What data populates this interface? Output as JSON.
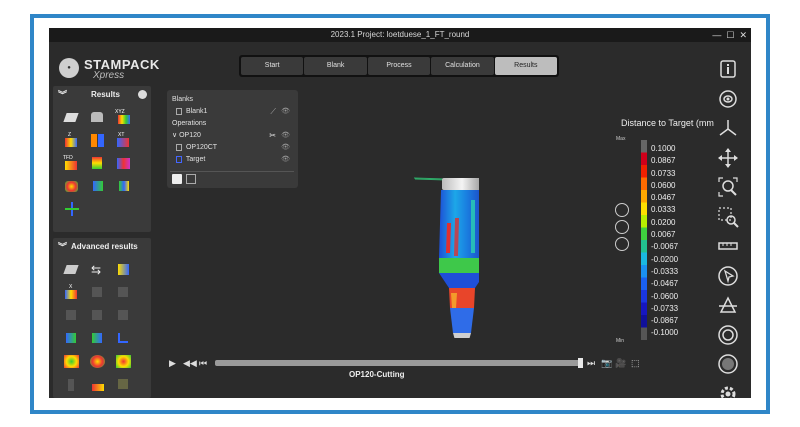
{
  "window": {
    "title": "2023.1  Project: loetduese_1_FT_round",
    "controls": [
      "—",
      "☐",
      "✕"
    ]
  },
  "logo": {
    "main": "STAMPACK",
    "sub": "Xpress"
  },
  "tabs": [
    {
      "label": "Start",
      "active": false
    },
    {
      "label": "Blank",
      "active": false
    },
    {
      "label": "Process",
      "active": false
    },
    {
      "label": "Calculation",
      "active": false
    },
    {
      "label": "Results",
      "active": true
    }
  ],
  "results_panel": {
    "title": "Results",
    "chevron": "︾"
  },
  "advanced_panel": {
    "title": "Advanced results",
    "chevron": "︾"
  },
  "tree": {
    "blanks_label": "Blanks",
    "blank1": "Blank1",
    "operations_label": "Operations",
    "op120": "OP120",
    "op120ct": "OP120CT",
    "target": "Target",
    "toggle_chevron": "∨"
  },
  "legend": {
    "title": "Distance to Target (mm",
    "max_label": "Max",
    "min_label": "Min",
    "values": [
      "0.1000",
      "0.0867",
      "0.0733",
      "0.0600",
      "0.0467",
      "0.0333",
      "0.0200",
      "0.0067",
      "-0.0067",
      "-0.0200",
      "-0.0333",
      "-0.0467",
      "-0.0600",
      "-0.0733",
      "-0.0867",
      "-0.1000"
    ]
  },
  "timeline": {
    "operation": "OP120-Cutting",
    "progress": 1.0
  },
  "colors": {
    "accent_frame": "#2f86c8",
    "tab_active": "#bdbdbd",
    "background": "#2b2b2b"
  },
  "icons": {
    "right_toolbar": [
      "info-icon",
      "rotate-view-icon",
      "axes-icon",
      "move-icon",
      "zoom-fit-icon",
      "zoom-window-icon",
      "ruler-icon",
      "pointer-icon",
      "section-icon",
      "view-ring-icon",
      "sphere-icon",
      "settings-gear-icon"
    ]
  }
}
